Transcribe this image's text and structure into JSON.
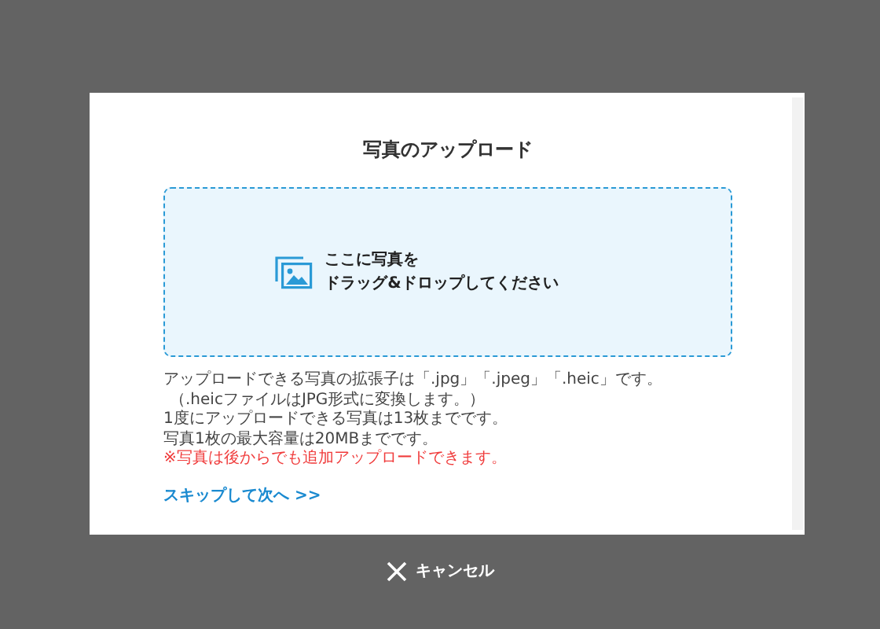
{
  "dialog": {
    "title": "写真のアップロード",
    "dropzone": {
      "lines": [
        "ここに写真を",
        "ドラッグ&ドロップしてください"
      ]
    },
    "notes": [
      {
        "text": "アップロードできる写真の拡張子は「.jpg」「.jpeg」「.heic」です。",
        "kind": "normal"
      },
      {
        "text": "（.heicファイルはJPG形式に変換します。）",
        "kind": "small"
      },
      {
        "text": "1度にアップロードできる写真は13枚までです。",
        "kind": "normal"
      },
      {
        "text": "写真1枚の最大容量は20MBまでです。",
        "kind": "normal"
      },
      {
        "text": "※写真は後からでも追加アップロードできます。",
        "kind": "warning"
      }
    ],
    "skip_link": "スキップして次へ >>"
  },
  "cancel_button": "キャンセル"
}
